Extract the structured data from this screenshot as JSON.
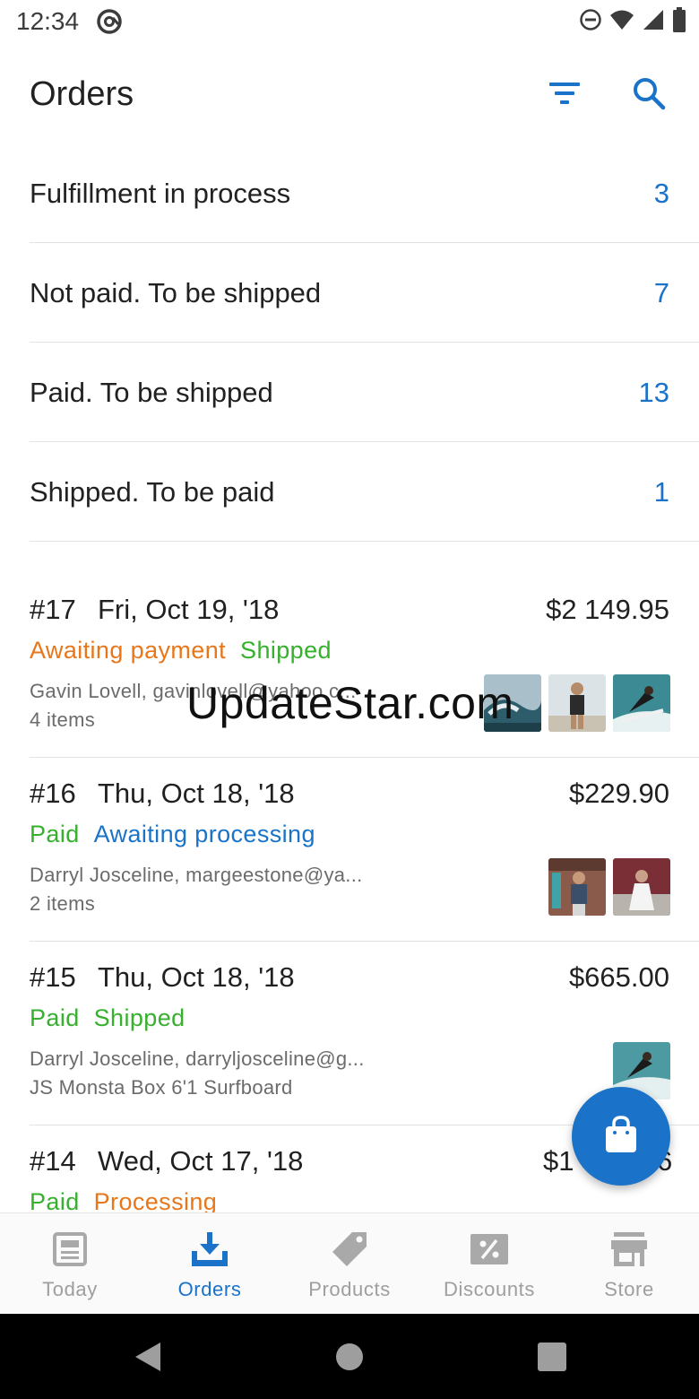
{
  "status_bar": {
    "time": "12:34",
    "icons": [
      "at-sign-icon",
      "do-not-disturb-icon",
      "wifi-icon",
      "signal-icon",
      "battery-icon"
    ]
  },
  "app_bar": {
    "title": "Orders",
    "actions": [
      "filter-icon",
      "search-icon"
    ]
  },
  "summary": [
    {
      "label": "Fulfillment in process",
      "count": "3"
    },
    {
      "label": "Not paid. To be shipped",
      "count": "7"
    },
    {
      "label": "Paid. To be shipped",
      "count": "13"
    },
    {
      "label": "Shipped. To be paid",
      "count": "1"
    }
  ],
  "orders": [
    {
      "number": "#17",
      "date": "Fri, Oct 19, '18",
      "total": "$2 149.95",
      "statuses": [
        "Awaiting payment",
        "Shipped"
      ],
      "customer": "Gavin Lovell, gavinlovell@yahoo.c...",
      "items": "4 items"
    },
    {
      "number": "#16",
      "date": "Thu, Oct 18, '18",
      "total": "$229.90",
      "statuses": [
        "Paid",
        "Awaiting processing"
      ],
      "customer": "Darryl Josceline, margeestone@ya...",
      "items": "2 items"
    },
    {
      "number": "#15",
      "date": "Thu, Oct 18, '18",
      "total": "$665.00",
      "statuses": [
        "Paid",
        "Shipped"
      ],
      "customer": "Darryl Josceline, darryljosceline@g...",
      "items": "JS Monsta Box 6'1 Surfboard"
    },
    {
      "number": "#14",
      "date": "Wed, Oct 17, '18",
      "total": "$1",
      "total_tail": "6",
      "statuses": [
        "Paid",
        "Processing"
      ]
    }
  ],
  "watermark": "UpdateStar.com",
  "bottom_nav": [
    {
      "label": "Today",
      "icon": "newspaper-icon"
    },
    {
      "label": "Orders",
      "icon": "download-tray-icon",
      "active": true
    },
    {
      "label": "Products",
      "icon": "tag-icon"
    },
    {
      "label": "Discounts",
      "icon": "percent-ticket-icon"
    },
    {
      "label": "Store",
      "icon": "storefront-icon"
    }
  ],
  "colors": {
    "accent": "#1a73c8",
    "status_orange": "#e8761a",
    "status_green": "#36b02d",
    "text_primary": "#212121",
    "text_secondary": "#6b6b6b"
  }
}
